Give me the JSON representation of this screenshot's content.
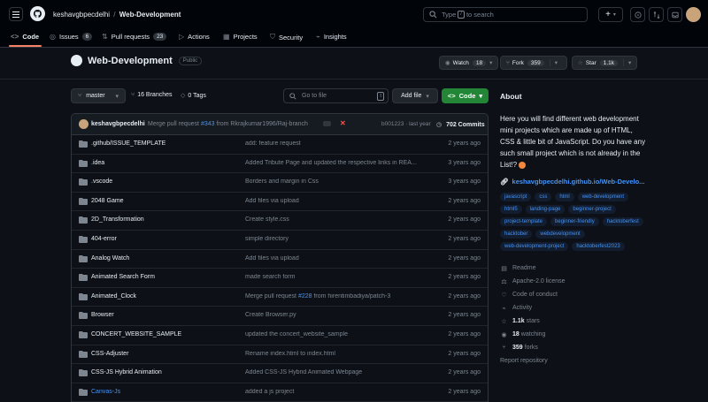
{
  "header": {
    "owner": "keshavgbpecdelhi",
    "separator": "/",
    "repo": "Web-Development",
    "search_prefix": "Type",
    "search_key": "/",
    "search_suffix": "to search"
  },
  "tabs": [
    {
      "label": "Code",
      "icon": "code-icon"
    },
    {
      "label": "Issues",
      "count": "6",
      "icon": "issue-icon"
    },
    {
      "label": "Pull requests",
      "count": "23",
      "icon": "pull-request-icon"
    },
    {
      "label": "Actions",
      "icon": "play-icon"
    },
    {
      "label": "Projects",
      "icon": "table-icon"
    },
    {
      "label": "Security",
      "icon": "shield-icon"
    },
    {
      "label": "Insights",
      "icon": "graph-icon"
    }
  ],
  "repo_header": {
    "name": "Web-Development",
    "visibility": "Public",
    "watch_label": "Watch",
    "watch_count": "18",
    "fork_label": "Fork",
    "fork_count": "359",
    "star_label": "Star",
    "star_count": "1.1k"
  },
  "toolbar": {
    "branch": "master",
    "branches": "16 Branches",
    "tags": "0 Tags",
    "goto_placeholder": "Go to file",
    "goto_key": "t",
    "add_file": "Add file",
    "code": "Code"
  },
  "latest_commit": {
    "author": "keshavgbpecdelhi",
    "msg_prefix": "Merge pull request",
    "pr": "#343",
    "msg_suffix": "from Rkrajkumar1996/Raj-branch",
    "sha_time": "b001223 · last year",
    "commits": "702 Commits"
  },
  "files": [
    {
      "name": ".github/ISSUE_TEMPLATE",
      "message": "add: feature request",
      "date": "2 years ago"
    },
    {
      "name": ".idea",
      "message": "Added Tribute Page and updated the respective links in REA...",
      "date": "3 years ago"
    },
    {
      "name": ".vscode",
      "message": "Borders and margin in Css",
      "date": "3 years ago"
    },
    {
      "name": "2048 Game",
      "message": "Add files via upload",
      "date": "2 years ago"
    },
    {
      "name": "2D_Transformation",
      "message": "Create style.css",
      "date": "2 years ago"
    },
    {
      "name": "404-error",
      "message": "simple directory",
      "date": "2 years ago"
    },
    {
      "name": "Analog Watch",
      "message": "Add files via upload",
      "date": "2 years ago"
    },
    {
      "name": "Animated Search Form",
      "message": "made search form",
      "date": "2 years ago"
    },
    {
      "name": "Animated_Clock",
      "message_prefix": "Merge pull request",
      "pr": "#228",
      "message_suffix": "from hirentimbadiya/patch-3",
      "date": "2 years ago"
    },
    {
      "name": "Browser",
      "message": "Create Browser.py",
      "date": "2 years ago"
    },
    {
      "name": "CONCERT_WEBSITE_SAMPLE",
      "message": "updated the concert_website_sample",
      "date": "2 years ago"
    },
    {
      "name": "CSS-Adjuster",
      "message": "Rename index.html to index.html",
      "date": "2 years ago"
    },
    {
      "name": "CSS-JS Hybrid Animation",
      "message": "Added CSS-JS Hybrid Animated Webpage",
      "date": "2 years ago"
    },
    {
      "name": "Canvas-Js",
      "message": "added a js project",
      "date": "2 years ago"
    }
  ],
  "about": {
    "title": "About",
    "description": "Here you will find different web development mini projects which are made up of HTML, CSS & little bit of JavaScript. Do you have any such small project which is not already in the List!?",
    "link": "keshavgbpecdelhi.github.io/Web-Develo...",
    "topics": [
      "javascript",
      "css",
      "html",
      "web-development",
      "html5",
      "landing-page",
      "beginner-project",
      "project-template",
      "beginner-friendly",
      "hacktoberfest",
      "hacktober",
      "webdevelopment",
      "web-development-project",
      "hacktoberfest2023"
    ],
    "readme": "Readme",
    "license": "Apache-2.0 license",
    "conduct": "Code of conduct",
    "activity": "Activity",
    "stars_n": "1.1k",
    "stars_l": "stars",
    "watching_n": "18",
    "watching_l": "watching",
    "forks_n": "359",
    "forks_l": "forks",
    "report": "Report repository"
  }
}
